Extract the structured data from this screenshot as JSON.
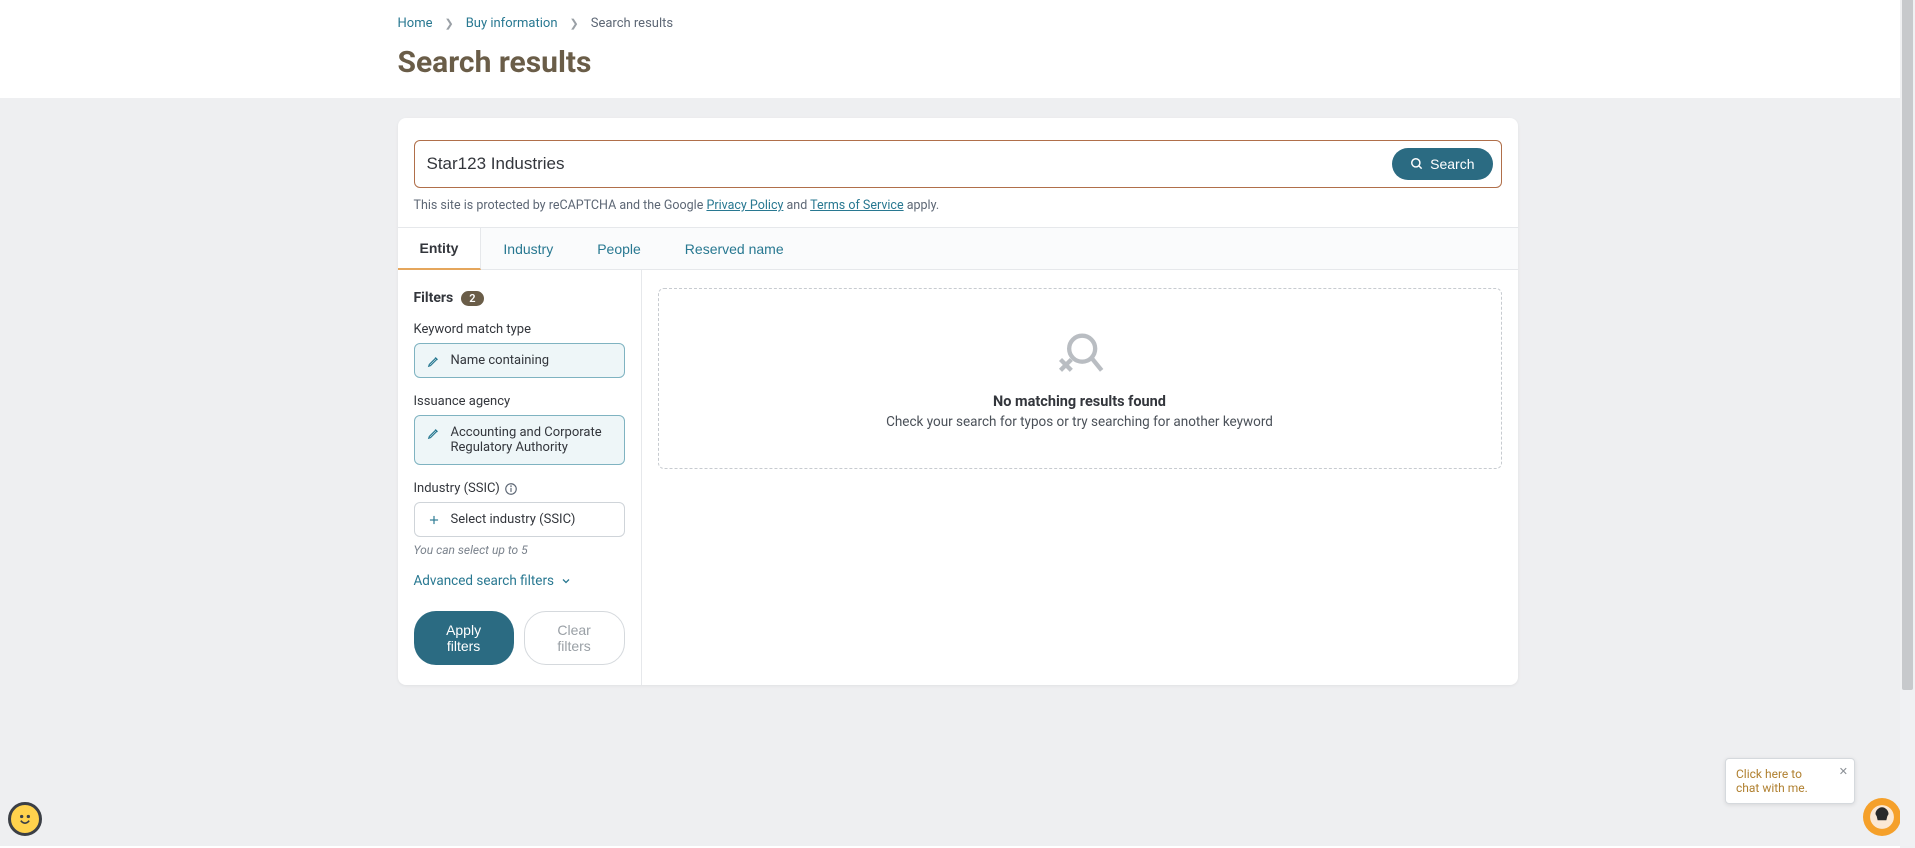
{
  "breadcrumb": {
    "home": "Home",
    "buy_info": "Buy information",
    "current": "Search results"
  },
  "page_title": "Search results",
  "search": {
    "value": "Star123 Industries",
    "button": "Search",
    "captcha_prefix": "This site is protected by reCAPTCHA and the Google ",
    "privacy": "Privacy Policy",
    "and": " and ",
    "terms": "Terms of Service",
    "apply": " apply."
  },
  "tabs": {
    "entity": "Entity",
    "industry": "Industry",
    "people": "People",
    "reserved": "Reserved name"
  },
  "filters": {
    "heading": "Filters",
    "count": "2",
    "keyword_label": "Keyword match type",
    "keyword_value": "Name containing",
    "agency_label": "Issuance agency",
    "agency_value": "Accounting and Corporate Regulatory Authority",
    "industry_label": "Industry (SSIC)",
    "industry_placeholder": "Select industry (SSIC)",
    "industry_hint": "You can select up to 5",
    "advanced": "Advanced search filters",
    "apply_btn": "Apply filters",
    "clear_btn": "Clear filters"
  },
  "empty": {
    "title": "No matching results found",
    "subtitle": "Check your search for typos or try searching for another keyword"
  },
  "chat_tooltip": "Click here to chat with me."
}
